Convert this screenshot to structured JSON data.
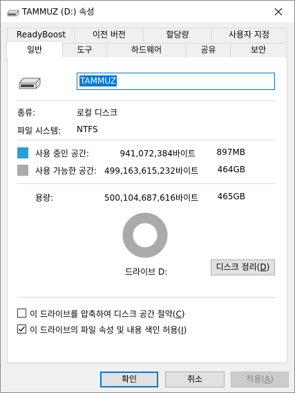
{
  "window": {
    "title": "TAMMUZ (D:) 속성",
    "close_icon": "close-icon",
    "title_icon": "drive-icon"
  },
  "tabs_back": [
    "ReadyBoost",
    "이전 버전",
    "할당량",
    "사용자 지정"
  ],
  "tabs_front": [
    "일반",
    "도구",
    "하드웨어",
    "공유",
    "보안"
  ],
  "active_tab": "일반",
  "general": {
    "name_value": "TAMMUZ",
    "type_label": "종류:",
    "type_value": "로컬 디스크",
    "fs_label": "파일 시스템:",
    "fs_value": "NTFS",
    "used_label": "사용 중인 공간:",
    "used_bytes": "941,072,384바이트",
    "used_size": "897MB",
    "used_color": "#26a0da",
    "free_label": "사용 가능한 공간:",
    "free_bytes": "499,163,615,232바이트",
    "free_size": "464GB",
    "free_color": "#aaaaaa",
    "capacity_label": "용량:",
    "capacity_bytes": "500,104,687,616바이트",
    "capacity_size": "465GB",
    "drive_label": "드라이브 D:",
    "cleanup_button": "디스크 정리(",
    "cleanup_key": "D",
    "cleanup_end": ")",
    "compress_text": "이 드라이브를 압축하여 디스크 공간 절약(",
    "compress_key": "C",
    "compress_end": ")",
    "compress_checked": false,
    "index_text": "이 드라이브의 파일 속성 및 내용 색인 허용(",
    "index_key": "I",
    "index_end": ")",
    "index_checked": true,
    "used_fraction": 0.0019
  },
  "buttons": {
    "ok": "확인",
    "cancel": "취소",
    "apply": "적용(",
    "apply_key": "A",
    "apply_end": ")"
  }
}
